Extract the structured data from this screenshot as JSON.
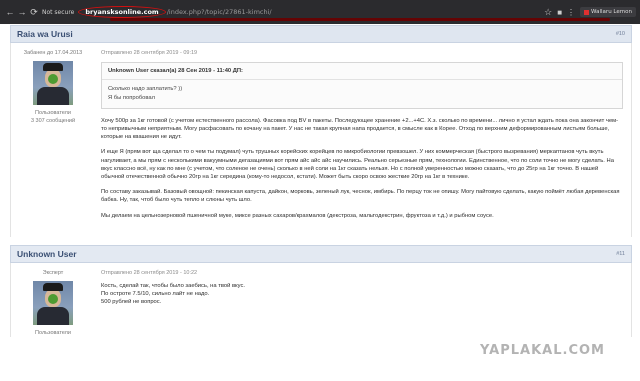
{
  "browser": {
    "security_label": "Not secure",
    "domain": "bryansksonline.com",
    "path": "/index.php?/topic/27861-kimchi/",
    "bookmark_label": "Wallaru Lemon"
  },
  "posts": [
    {
      "author": "Raia wa Urusi",
      "number": "#10",
      "user_lines": [
        "Забанен до 17.04.2013",
        "Пользователи",
        "3 307 сообщений"
      ],
      "date": "Отправлено 28 сентября 2019 - 09:19",
      "quote_head": "Unknown User сказал(а) 28 Сен 2019 - 11:40 ДП:",
      "quote_lines": [
        "Сколько надо заплатить? ))",
        "Я бы попробовал"
      ],
      "paragraphs": [
        "Хочу 500р за 1кг готовой (с учетом естественного рассола). Фасовка под BV в пакеты. Последующее хранение +2...+4С. Х.з. сколько по времени... лично я устал ждать пока она закончит чем-то непривычным неприятным. Могу расфасовать по кочану на пакет. У нас не такая крупная напа продается, в смысле как в Корее. Отход по верхним деформированным листьям больше, которые на квашения не идут.",
        "И еще Я (прям вот ща сделал то о чем ты подумал) чуть трушных корейских корейцев по микробиологии превзошел. У них коммерческая (быстрого вызревания) меркаптанов чуть вкуть нагуливает, а мы прям с несколькими вакуумными дегазациями вот прям айс айс айс научились. Реально серьезные прям, технологии. Единственное, что по соли точно не могу сделать. На вкус классно всё, ну как по мне (с учетом, что соленое не очень) сколько в ней соли на 1кг сказать нельзя. Но с полной уверенностью можно сказать, что до 25гр на 1кг точно. В нашей обычной отечественной обычно 20гр на 1кг середина (кому-то недосол, кстати). Может быть скоро освою жесткие 20гр на 1кг в технике.",
        "По составу заказывай. Базовый овощной: пекинская капуста, дайкон, морковь, зеленый лук, чеснок, имбирь. По перцу ток не опишу. Могу пайтовую сделать, какую поймёт любая деревенская бабка. Ну, так, чтоб было чуть тепло и слюны чуть шло.",
        "Мы делаем на цельнозерновой пшеничной муке, миксе разных сахаров/крахмалов (декстроза, мальтодекстрин, фруктоза и т.д.) и рыбном соусе."
      ]
    },
    {
      "author": "Unknown User",
      "number": "#11",
      "user_lines": [
        "Эксперт",
        "Пользователи"
      ],
      "date": "Отправлено 28 сентября 2019 - 10:22",
      "paragraphs": [
        "Кость, сделай так, чтобы было заебись, на твой вкус.",
        "По остроте 7.5/10, сильно лайт не надо.",
        "500 рублей не вопрос."
      ]
    }
  ],
  "watermark": "YAPLAKAL.COM"
}
